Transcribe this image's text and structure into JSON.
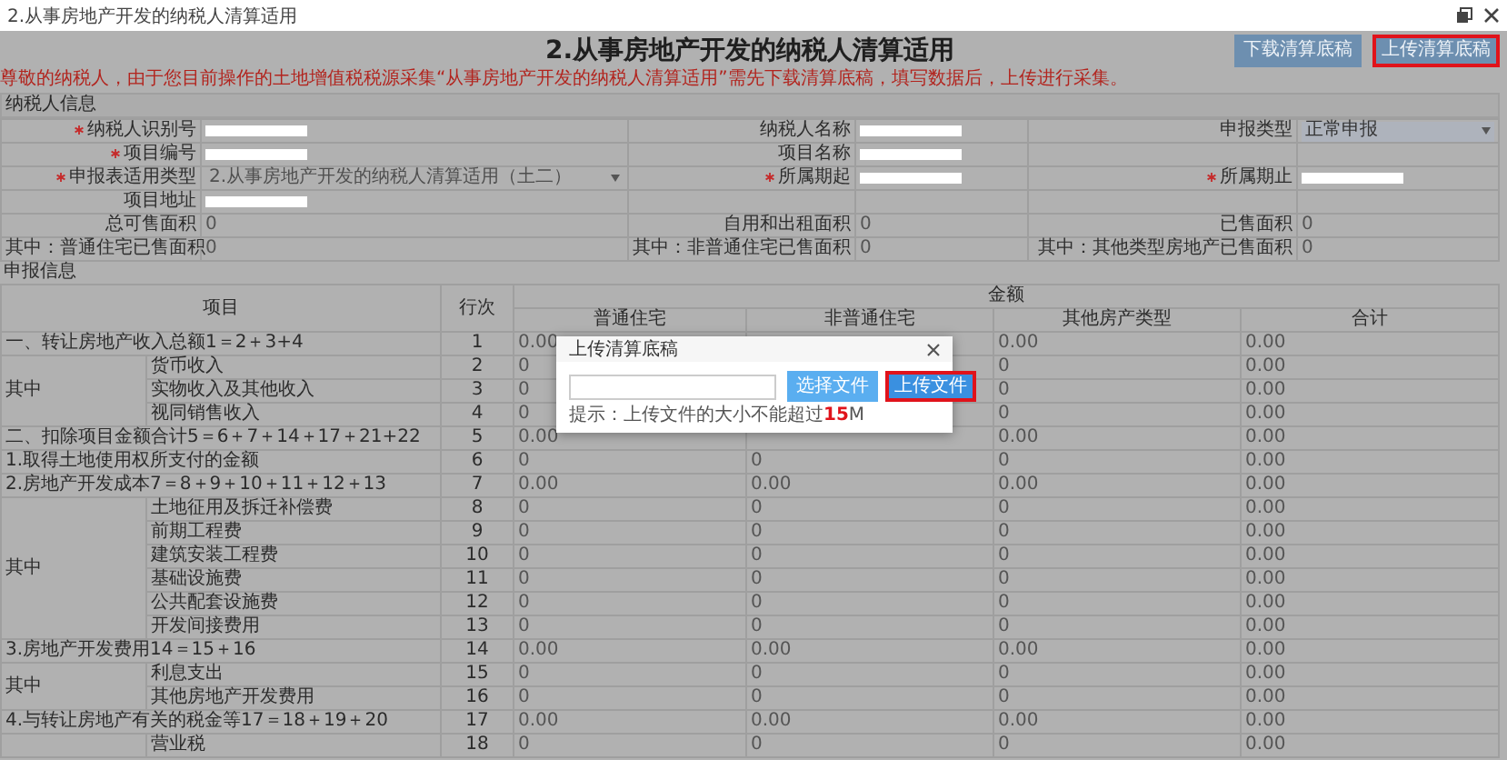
{
  "window": {
    "title": "2.从事房地产开发的纳税人清算适用"
  },
  "page": {
    "title": "2.从事房地产开发的纳税人清算适用",
    "buttons": [
      {
        "label": "下载清算底稿",
        "highlighted": false
      },
      {
        "label": "上传清算底稿",
        "highlighted": true
      }
    ],
    "notice": "尊敬的纳税人，由于您目前操作的土地增值税税源采集“从事房地产开发的纳税人清算适用”需先下载清算底稿，填写数据后，上传进行采集。"
  },
  "taxpayer_info": {
    "title": "纳税人信息",
    "rows": [
      {
        "fields": [
          {
            "label": "纳税人识别号",
            "required": true,
            "kind": "redacted"
          },
          {
            "label": "纳税人名称",
            "required": false,
            "kind": "redacted"
          },
          {
            "label": "申报类型",
            "required": false,
            "kind": "select",
            "value": "正常申报",
            "disabled": false
          }
        ]
      },
      {
        "fields": [
          {
            "label": "项目编号",
            "required": true,
            "kind": "redacted"
          },
          {
            "label": "项目名称",
            "required": false,
            "kind": "redacted"
          }
        ]
      },
      {
        "fields": [
          {
            "label": "申报表适用类型",
            "required": true,
            "kind": "select",
            "value": "2.从事房地产开发的纳税人清算适用（土二）",
            "disabled": true
          },
          {
            "label": "所属期起",
            "required": true,
            "kind": "redacted"
          },
          {
            "label": "所属期止",
            "required": true,
            "kind": "redacted"
          }
        ]
      },
      {
        "fields": [
          {
            "label": "项目地址",
            "required": false,
            "kind": "redacted"
          }
        ]
      },
      {
        "fields": [
          {
            "label": "总可售面积",
            "required": false,
            "kind": "text",
            "value": "0"
          },
          {
            "label": "自用和出租面积",
            "required": false,
            "kind": "text",
            "value": "0"
          },
          {
            "label": "已售面积",
            "required": false,
            "kind": "text",
            "value": "0"
          }
        ]
      },
      {
        "fields": [
          {
            "label": "其中：普通住宅已售面积",
            "required": false,
            "kind": "text",
            "value": "0"
          },
          {
            "label": "其中：非普通住宅已售面积",
            "required": false,
            "kind": "text",
            "value": "0"
          },
          {
            "label": "其中：其他类型房地产已售面积",
            "required": false,
            "kind": "text",
            "value": "0"
          }
        ]
      }
    ]
  },
  "declaration": {
    "title": "申报信息",
    "columns": {
      "item": "项目",
      "line": "行次",
      "amount": "金额",
      "amount_columns": [
        "普通住宅",
        "非普通住宅",
        "其他房产类型",
        "合计"
      ]
    },
    "rows": [
      {
        "kind": "item",
        "label": "一、转让房地产收入总额1＝2＋3+4",
        "line": "1",
        "values": {
          "ordinary": "0.00",
          "other": "0.00",
          "total": "0.00"
        }
      },
      {
        "kind": "group",
        "label": "其中",
        "children": [
          {
            "label": "货币收入",
            "line": "2",
            "values": {
              "ordinary": "0",
              "other": "0",
              "total": "0.00"
            }
          },
          {
            "label": "实物收入及其他收入",
            "line": "3",
            "values": {
              "ordinary": "0",
              "other": "0",
              "total": "0.00"
            }
          },
          {
            "label": "视同销售收入",
            "line": "4",
            "values": {
              "ordinary": "0",
              "other": "0",
              "total": "0.00"
            }
          }
        ]
      },
      {
        "kind": "item",
        "label": "二、扣除项目金额合计5＝6＋7＋14＋17＋21+22",
        "line": "5",
        "values": {
          "ordinary": "0.00",
          "other": "0.00",
          "total": "0.00"
        }
      },
      {
        "kind": "item",
        "label": "1.取得土地使用权所支付的金额",
        "line": "6",
        "values": {
          "ordinary": "0",
          "non_ordinary": "0",
          "other": "0",
          "total": "0.00"
        }
      },
      {
        "kind": "item",
        "label": "2.房地产开发成本7＝8＋9＋10＋11＋12＋13",
        "line": "7",
        "values": {
          "ordinary": "0.00",
          "non_ordinary": "0.00",
          "other": "0.00",
          "total": "0.00"
        }
      },
      {
        "kind": "group",
        "label": "其中",
        "children": [
          {
            "label": "土地征用及拆迁补偿费",
            "line": "8",
            "values": {
              "ordinary": "0",
              "non_ordinary": "0",
              "other": "0",
              "total": "0.00"
            }
          },
          {
            "label": "前期工程费",
            "line": "9",
            "values": {
              "ordinary": "0",
              "non_ordinary": "0",
              "other": "0",
              "total": "0.00"
            }
          },
          {
            "label": "建筑安装工程费",
            "line": "10",
            "values": {
              "ordinary": "0",
              "non_ordinary": "0",
              "other": "0",
              "total": "0.00"
            }
          },
          {
            "label": "基础设施费",
            "line": "11",
            "values": {
              "ordinary": "0",
              "non_ordinary": "0",
              "other": "0",
              "total": "0.00"
            }
          },
          {
            "label": "公共配套设施费",
            "line": "12",
            "values": {
              "ordinary": "0",
              "non_ordinary": "0",
              "other": "0",
              "total": "0.00"
            }
          },
          {
            "label": "开发间接费用",
            "line": "13",
            "values": {
              "ordinary": "0",
              "non_ordinary": "0",
              "other": "0",
              "total": "0.00"
            }
          }
        ]
      },
      {
        "kind": "item",
        "label": "3.房地产开发费用14＝15＋16",
        "line": "14",
        "values": {
          "ordinary": "0.00",
          "non_ordinary": "0.00",
          "other": "0.00",
          "total": "0.00"
        }
      },
      {
        "kind": "group",
        "label": "其中",
        "children": [
          {
            "label": "利息支出",
            "line": "15",
            "values": {
              "ordinary": "0",
              "non_ordinary": "0",
              "other": "0",
              "total": "0.00"
            }
          },
          {
            "label": "其他房地产开发费用",
            "line": "16",
            "values": {
              "ordinary": "0",
              "non_ordinary": "0",
              "other": "0",
              "total": "0.00"
            }
          }
        ]
      },
      {
        "kind": "item",
        "label": "4.与转让房地产有关的税金等17＝18＋19＋20",
        "line": "17",
        "values": {
          "ordinary": "0.00",
          "non_ordinary": "0.00",
          "other": "0.00",
          "total": "0.00"
        }
      },
      {
        "kind": "group",
        "children": [
          {
            "label": "营业税",
            "line": "18",
            "values": {
              "ordinary": "0",
              "non_ordinary": "0",
              "other": "0",
              "total": "0.00"
            }
          }
        ]
      }
    ]
  },
  "modal": {
    "title": "上传清算底稿",
    "buttons": [
      {
        "label": "选择文件",
        "highlighted": false
      },
      {
        "label": "上传文件",
        "highlighted": true
      }
    ],
    "hint": "提示：上传文件的大小不能超过**15**M"
  }
}
